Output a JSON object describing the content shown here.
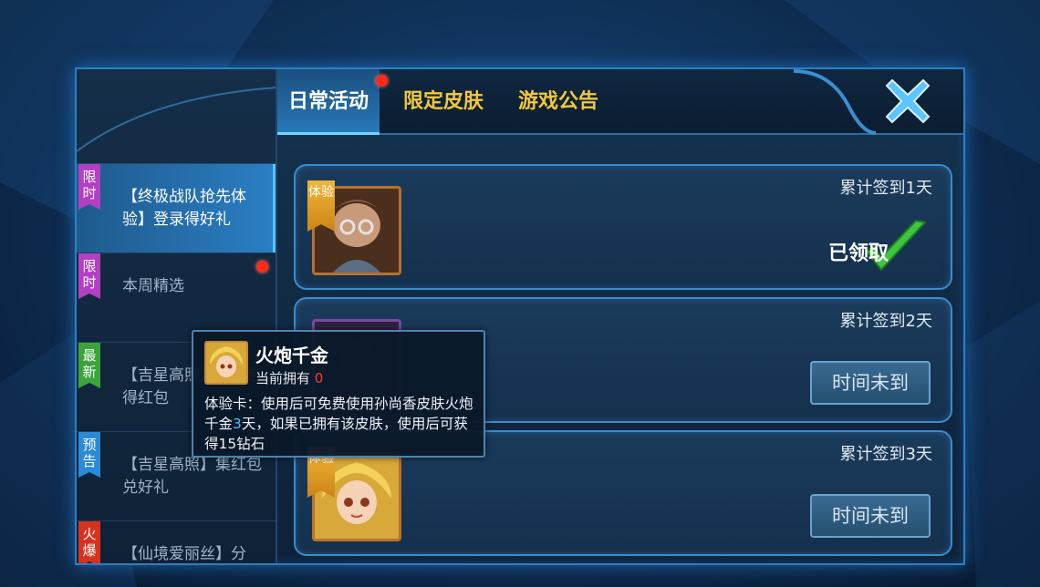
{
  "tabs": [
    {
      "label": "日常活动",
      "active": true,
      "has_notification": true
    },
    {
      "label": "限定皮肤",
      "active": false
    },
    {
      "label": "游戏公告",
      "active": false
    }
  ],
  "sidebar": {
    "items": [
      {
        "badge": "限时",
        "badge_color": "#b43ec4",
        "label": "【终极战队抢先体验】登录得好礼",
        "active": true,
        "has_notification": false
      },
      {
        "badge": "限时",
        "badge_color": "#b43ec4",
        "label": "本周精选",
        "active": false,
        "has_notification": true
      },
      {
        "badge": "最新",
        "badge_color": "#3aa43a",
        "label": "【吉星高照】集红包得红包",
        "active": false,
        "has_notification": false
      },
      {
        "badge": "预告",
        "badge_color": "#2a8ad6",
        "label": "【吉星高照】集红包兑好礼",
        "active": false,
        "has_notification": false
      },
      {
        "badge": "火爆",
        "badge_color": "#d8321e",
        "label": "【仙境爱丽丝】分",
        "active": false,
        "has_notification": false
      }
    ]
  },
  "rewards": [
    {
      "label": "累计签到1天",
      "tag": "体验",
      "status": "已领取",
      "claimed": true
    },
    {
      "label": "累计签到2天",
      "tag": "",
      "status": "时间未到",
      "claimed": false
    },
    {
      "label": "累计签到3天",
      "tag": "体验",
      "status": "时间未到",
      "claimed": false
    }
  ],
  "tooltip": {
    "name": "火炮千金",
    "own_label": "当前拥有",
    "own_count": "0",
    "desc_before": "体验卡：使用后可免费使用孙尚香皮肤火炮千金",
    "desc_days": "3",
    "desc_after": "天，如果已拥有该皮肤，使用后可获得15钻石"
  },
  "icons": {
    "close": "close-x-icon",
    "claimed": "checkmark-icon"
  },
  "colors": {
    "accent": "#2b7fc4",
    "tab_gold": "#f3c73a",
    "notification": "#ff2a1a"
  }
}
